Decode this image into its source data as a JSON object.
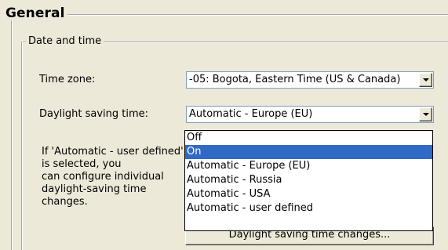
{
  "general": {
    "title": "General"
  },
  "date_and_time": {
    "title": "Date and time",
    "time_zone": {
      "label": "Time zone:",
      "value": "-05: Bogota, Eastern Time (US & Canada)"
    },
    "daylight_saving": {
      "label": "Daylight saving time:",
      "value": "Automatic - Europe (EU)",
      "options": [
        "Off",
        "On",
        "Automatic - Europe (EU)",
        "Automatic - Russia",
        "Automatic - USA",
        "Automatic - user defined"
      ],
      "highlighted_option": "On"
    },
    "help_text": "If 'Automatic - user defined' is selected, you\ncan configure individual\ndaylight-saving time changes.",
    "changes_button": "Daylight saving time changes..."
  },
  "colors": {
    "highlight": "#316ac5",
    "window_bg": "#ece9d8"
  }
}
